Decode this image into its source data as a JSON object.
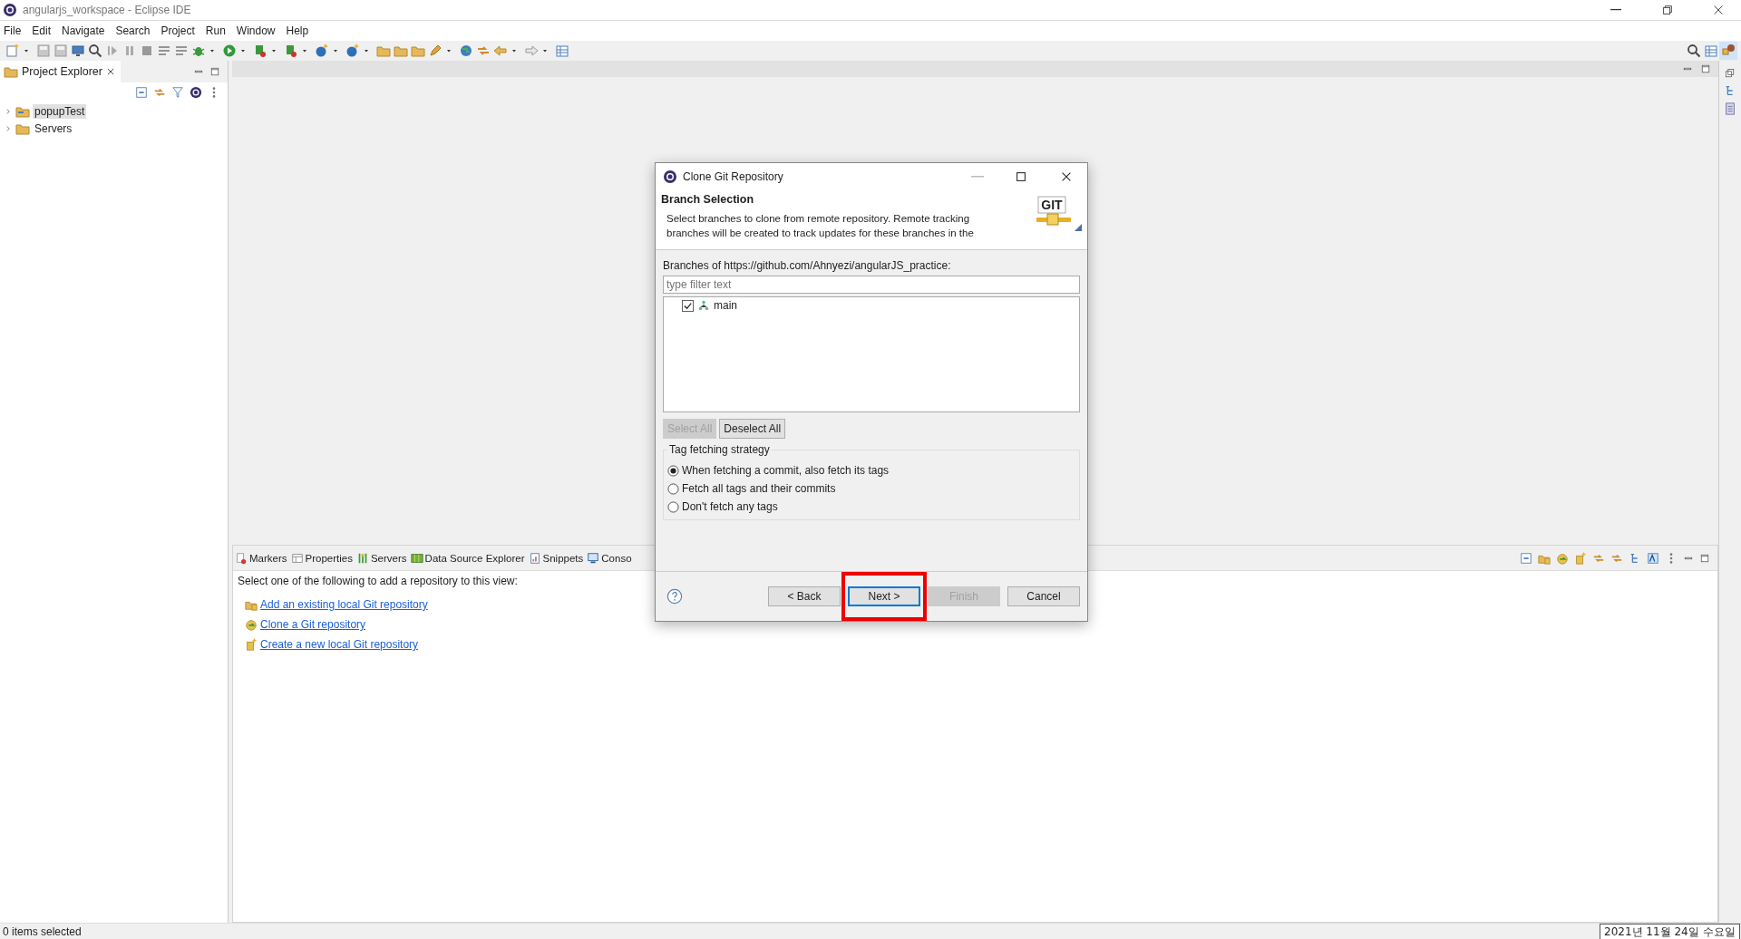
{
  "window": {
    "title": "angularjs_workspace - Eclipse IDE"
  },
  "menu": [
    "File",
    "Edit",
    "Navigate",
    "Search",
    "Project",
    "Run",
    "Window",
    "Help"
  ],
  "project_explorer": {
    "title": "Project Explorer",
    "items": [
      {
        "label": "popupTest",
        "kind": "project",
        "selected": true
      },
      {
        "label": "Servers",
        "kind": "folder",
        "selected": false
      }
    ]
  },
  "bottom_panel": {
    "tabs": [
      {
        "label": "Markers",
        "kind": "markers"
      },
      {
        "label": "Properties",
        "kind": "properties"
      },
      {
        "label": "Servers",
        "kind": "servers"
      },
      {
        "label": "Data Source Explorer",
        "kind": "datasource"
      },
      {
        "label": "Snippets",
        "kind": "snippets"
      },
      {
        "label": "Conso",
        "kind": "console"
      }
    ],
    "intro": "Select one of the following to add a repository to this view:",
    "links": [
      {
        "label": "Add an existing local Git repository",
        "kind": "add"
      },
      {
        "label": "Clone a Git repository",
        "kind": "clone"
      },
      {
        "label": "Create a new local Git repository",
        "kind": "create"
      }
    ]
  },
  "dialog": {
    "title": "Clone Git Repository",
    "heading": "Branch Selection",
    "logo_text": "GIT",
    "description_lines": [
      "Select branches to clone from remote repository. Remote tracking",
      "branches will be created to track updates for these branches in the"
    ],
    "branches_label": "Branches of https://github.com/Ahnyezi/angularJS_practice:",
    "filter": {
      "placeholder": "type filter text"
    },
    "branches": [
      {
        "label": "main",
        "checked": true
      }
    ],
    "list_buttons": [
      {
        "label": "Select All",
        "disabled": true
      },
      {
        "label": "Deselect All",
        "disabled": false
      }
    ],
    "tag_strategy": {
      "title": "Tag fetching strategy",
      "options": [
        {
          "label": "When fetching a commit, also fetch its tags",
          "selected": true
        },
        {
          "label": "Fetch all tags and their commits",
          "selected": false
        },
        {
          "label": "Don't fetch any tags",
          "selected": false
        }
      ]
    },
    "buttons": [
      {
        "label": "< Back",
        "disabled": false,
        "default": false,
        "highlighted": false
      },
      {
        "label": "Next >",
        "disabled": false,
        "default": true,
        "highlighted": true
      },
      {
        "label": "Finish",
        "disabled": true,
        "default": false,
        "highlighted": false
      },
      {
        "label": "Cancel",
        "disabled": false,
        "default": false,
        "highlighted": false
      }
    ]
  },
  "status_bar": {
    "text": "0 items selected"
  },
  "tooltip": {
    "text": "2021년 11월 24일 수요일"
  }
}
